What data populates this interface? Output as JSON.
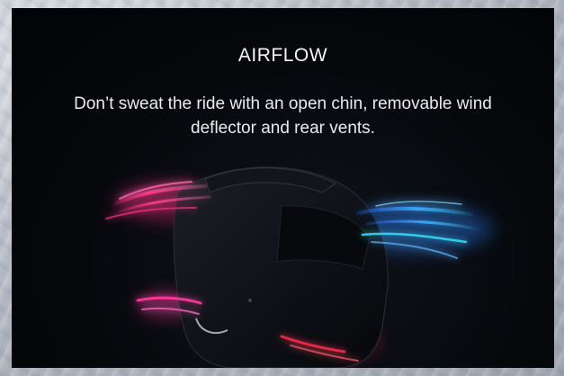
{
  "panel": {
    "title": "AIRFLOW",
    "description": "Don’t sweat the ride with an open chin, removable wind deflector and rear vents."
  },
  "image": {
    "subject": "helmet-airflow-illustration"
  },
  "colors": {
    "background_panel": "#05070b",
    "text": "#f2f4f7",
    "airflow_pink": "#ff2f86",
    "airflow_blue": "#3aa8ff",
    "airflow_cyan": "#36e0ff"
  }
}
